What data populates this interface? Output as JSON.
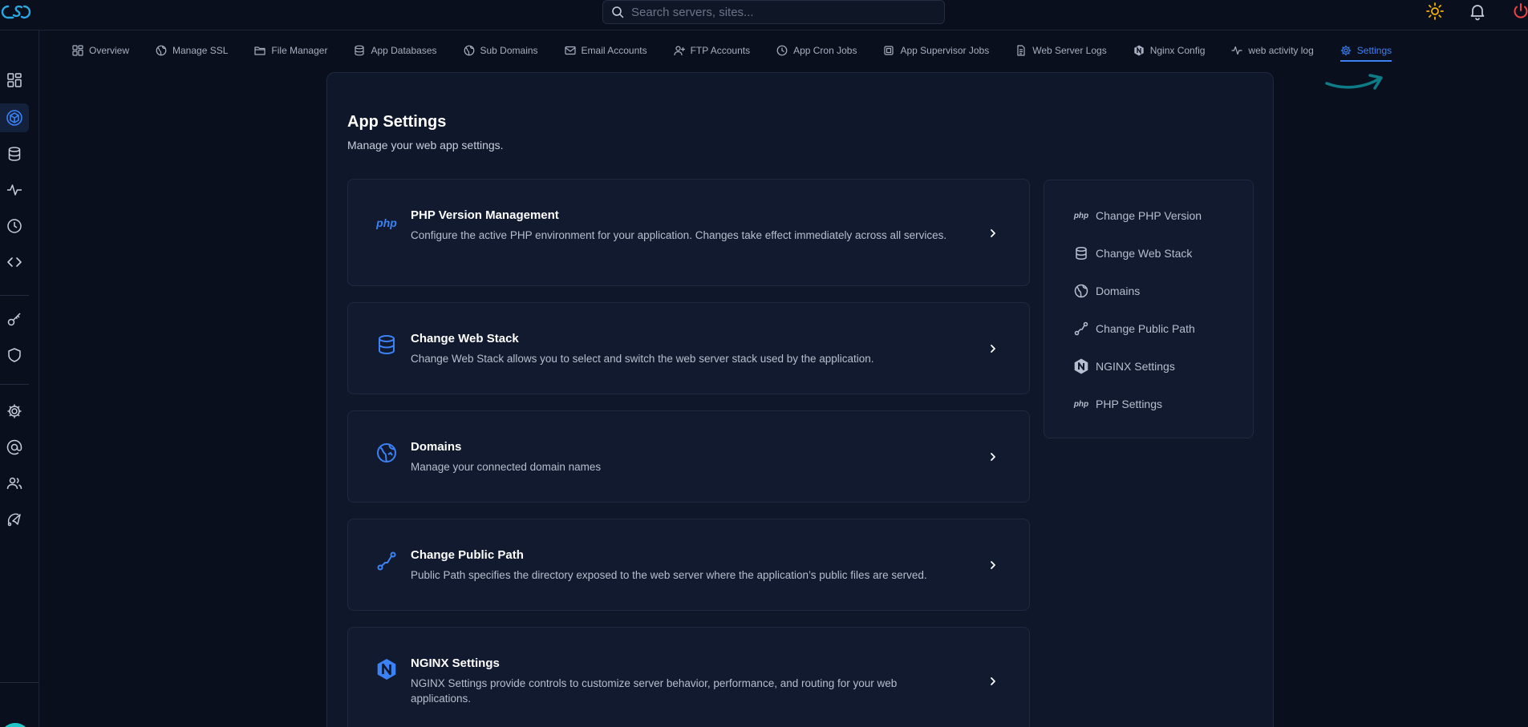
{
  "search": {
    "placeholder": "Search servers, sites..."
  },
  "tabs": [
    {
      "label": "Overview",
      "icon": "grid-icon"
    },
    {
      "label": "Manage SSL",
      "icon": "globe-icon"
    },
    {
      "label": "File Manager",
      "icon": "folder-icon"
    },
    {
      "label": "App Databases",
      "icon": "database-icon"
    },
    {
      "label": "Sub Domains",
      "icon": "globe-icon"
    },
    {
      "label": "Email Accounts",
      "icon": "mail-icon"
    },
    {
      "label": "FTP Accounts",
      "icon": "user-plus-icon"
    },
    {
      "label": "App Cron Jobs",
      "icon": "clock-icon"
    },
    {
      "label": "App Supervisor Jobs",
      "icon": "cpu-icon"
    },
    {
      "label": "Web Server Logs",
      "icon": "file-icon"
    },
    {
      "label": "Nginx Config",
      "icon": "nginx-icon"
    },
    {
      "label": "web activity log",
      "icon": "activity-icon"
    },
    {
      "label": "Settings",
      "icon": "gear-icon",
      "active": true
    }
  ],
  "page": {
    "title": "App Settings",
    "subtitle": "Manage your web app settings."
  },
  "cards": [
    {
      "title": "PHP Version Management",
      "desc": "Configure the active PHP environment for your application. Changes take effect immediately across all services.",
      "icon": "php-icon"
    },
    {
      "title": "Change Web Stack",
      "desc": "Change Web Stack allows you to select and switch the web server stack used by the application.",
      "icon": "database-icon"
    },
    {
      "title": "Domains",
      "desc": "Manage your connected domain names",
      "icon": "globe-icon"
    },
    {
      "title": "Change Public Path",
      "desc": "Public Path specifies the directory exposed to the web server where the application’s public files are served.",
      "icon": "path-icon"
    },
    {
      "title": "NGINX Settings",
      "desc": "NGINX Settings provide controls to customize server behavior, performance, and routing for your web applications.",
      "icon": "nginx-icon"
    }
  ],
  "quick_links": [
    {
      "label": "Change PHP Version",
      "icon": "php-icon"
    },
    {
      "label": "Change Web Stack",
      "icon": "database-icon"
    },
    {
      "label": "Domains",
      "icon": "globe-icon"
    },
    {
      "label": "Change Public Path",
      "icon": "path-icon"
    },
    {
      "label": "NGINX Settings",
      "icon": "nginx-icon"
    },
    {
      "label": "PHP Settings",
      "icon": "php-icon"
    }
  ],
  "icon_text": {
    "php": "php",
    "nginx": "N"
  },
  "colors": {
    "accent": "#3b82f6",
    "background": "#0a0f1e",
    "panel": "#0f172a",
    "sun": "#f5b301",
    "power": "#ef4444"
  }
}
